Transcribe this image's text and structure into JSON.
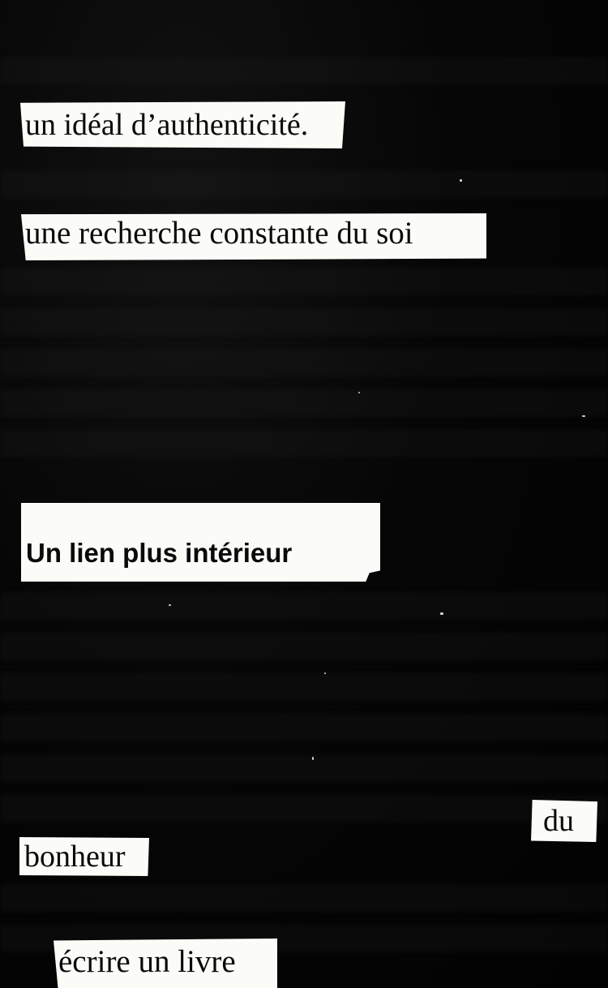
{
  "fragments": {
    "line1": "un idéal d’authenticité.",
    "line2": "une recherche constante du soi",
    "heading": "Un lien plus intérieur",
    "word_du": "du",
    "word_bonheur": "bonheur",
    "line_last": "écrire un livre"
  },
  "colors": {
    "background": "#050505",
    "paper": "#fbfbf8",
    "ink": "#0a0a0a"
  }
}
